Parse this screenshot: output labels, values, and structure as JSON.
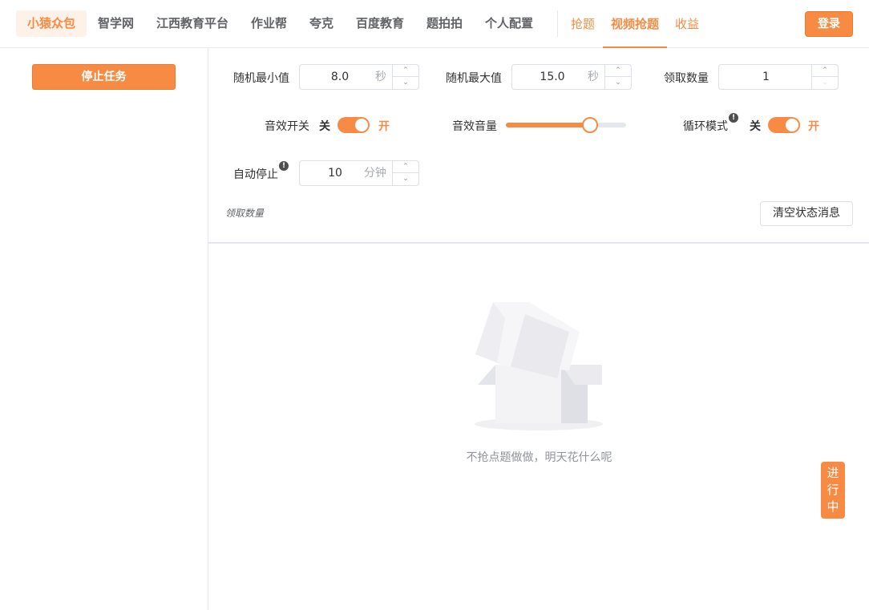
{
  "platforms": [
    {
      "label": "小猿众包",
      "active": true
    },
    {
      "label": "智学网",
      "active": false
    },
    {
      "label": "江西教育平台",
      "active": false
    },
    {
      "label": "作业帮",
      "active": false
    },
    {
      "label": "夸克",
      "active": false
    },
    {
      "label": "百度教育",
      "active": false
    },
    {
      "label": "题拍拍",
      "active": false
    },
    {
      "label": "个人配置",
      "active": false
    }
  ],
  "modes": [
    {
      "label": "抢题",
      "active": false
    },
    {
      "label": "视频抢题",
      "active": true
    },
    {
      "label": "收益",
      "active": false
    }
  ],
  "login_label": "登录",
  "sidebar": {
    "stop_label": "停止任务"
  },
  "settings": {
    "random_min": {
      "label": "随机最小值",
      "value": "8.0",
      "unit": "秒"
    },
    "random_max": {
      "label": "随机最大值",
      "value": "15.0",
      "unit": "秒"
    },
    "claim_count": {
      "label": "领取数量",
      "value": "1"
    },
    "sound_switch": {
      "label": "音效开关",
      "off_text": "关",
      "on_text": "开",
      "on": true
    },
    "sound_volume": {
      "label": "音效音量",
      "level_percent": 70
    },
    "loop_mode": {
      "label": "循环模式",
      "off_text": "关",
      "on_text": "开",
      "on": true
    },
    "auto_stop": {
      "label": "自动停止",
      "value": "10",
      "unit": "分钟"
    }
  },
  "hint_text": "领取数量",
  "clear_label": "清空状态消息",
  "empty": {
    "text": "不抢点题做做，明天花什么呢"
  },
  "running": {
    "label": [
      "进",
      "行",
      "中"
    ]
  },
  "colors": {
    "accent": "#f78b44",
    "accent_bg": "#fdf1e8",
    "border": "#dcdfe6"
  }
}
